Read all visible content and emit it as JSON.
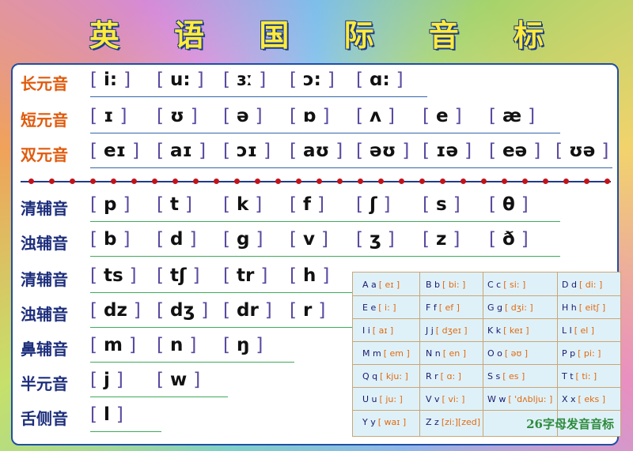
{
  "title": "英 语 国 际 音 标",
  "vowels": [
    {
      "label": "长元音",
      "symbols": [
        "i:",
        "u:",
        "ɜː",
        "ɔ:",
        "ɑ:"
      ]
    },
    {
      "label": "短元音",
      "symbols": [
        "ɪ",
        "ʊ",
        "ə",
        "ɒ",
        "ʌ",
        "e",
        "æ"
      ]
    },
    {
      "label": "双元音",
      "symbols": [
        "eɪ",
        "aɪ",
        "ɔɪ",
        "aʊ",
        "əʊ",
        "ɪə",
        "eə",
        "ʊə"
      ]
    }
  ],
  "consonants": [
    {
      "label": "清辅音",
      "symbols": [
        "p",
        "t",
        "k",
        "f",
        "ʃ",
        "s",
        "θ"
      ]
    },
    {
      "label": "浊辅音",
      "symbols": [
        "b",
        "d",
        "g",
        "v",
        "ʒ",
        "z",
        "ð"
      ]
    },
    {
      "label": "清辅音",
      "symbols": [
        "ts",
        "tʃ",
        "tr",
        "h"
      ]
    },
    {
      "label": "浊辅音",
      "symbols": [
        "dz",
        "dʒ",
        "dr",
        "r"
      ]
    },
    {
      "label": "鼻辅音",
      "symbols": [
        "m",
        "n",
        "ŋ"
      ]
    },
    {
      "label": "半元音",
      "symbols": [
        "j",
        "w"
      ]
    },
    {
      "label": "舌侧音",
      "symbols": [
        "l"
      ]
    }
  ],
  "alphabet": [
    {
      "letter": "A a",
      "ipa": "[ eɪ ]"
    },
    {
      "letter": "B b",
      "ipa": "[ bi: ]"
    },
    {
      "letter": "C c",
      "ipa": "[ si: ]"
    },
    {
      "letter": "D d",
      "ipa": "[ di: ]"
    },
    {
      "letter": "E e",
      "ipa": "[ i: ]"
    },
    {
      "letter": "F f",
      "ipa": "[ ef ]"
    },
    {
      "letter": "G g",
      "ipa": "[ dʒi: ]"
    },
    {
      "letter": "H h",
      "ipa": "[ eitʃ ]"
    },
    {
      "letter": "I i",
      "ipa": "[ aɪ ]"
    },
    {
      "letter": "J j",
      "ipa": "[ dʒeɪ ]"
    },
    {
      "letter": "K k",
      "ipa": "[ keɪ ]"
    },
    {
      "letter": "L l",
      "ipa": "[ el ]"
    },
    {
      "letter": "M m",
      "ipa": "[ em ]"
    },
    {
      "letter": "N n",
      "ipa": "[ en ]"
    },
    {
      "letter": "O o",
      "ipa": "[ əʊ ]"
    },
    {
      "letter": "P p",
      "ipa": "[ pi: ]"
    },
    {
      "letter": "Q q",
      "ipa": "[ kju: ]"
    },
    {
      "letter": "R r",
      "ipa": "[ ɑ: ]"
    },
    {
      "letter": "S s",
      "ipa": "[ es ]"
    },
    {
      "letter": "T t",
      "ipa": "[ ti: ]"
    },
    {
      "letter": "U u",
      "ipa": "[ ju: ]"
    },
    {
      "letter": "V v",
      "ipa": "[ vi: ]"
    },
    {
      "letter": "W w",
      "ipa": "[ 'dʌblju: ]"
    },
    {
      "letter": "X x",
      "ipa": "[ eks ]"
    },
    {
      "letter": "Y y",
      "ipa": "[ waɪ ]"
    },
    {
      "letter": "Z z",
      "ipa": "[zi:][zed]"
    }
  ],
  "alphabet_caption": "26字母发音音标",
  "colors": {
    "vowel_label": "#e05a0c",
    "consonant_label": "#1d2e7c",
    "title": "#ffeb3b",
    "ipa": "#e06a10"
  }
}
